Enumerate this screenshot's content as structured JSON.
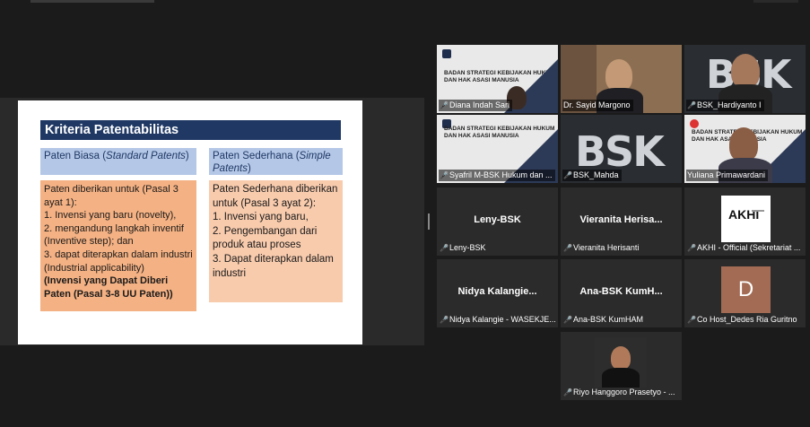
{
  "slide": {
    "title": "Kriteria Patentabilitas",
    "left_head_a": "Paten Biasa (",
    "left_head_i": "Standard Patents",
    "left_head_b": ")",
    "right_head_a": "Paten Sederhana (",
    "right_head_i": "Simple Patents",
    "right_head_b": ")",
    "left_body": [
      "Paten diberikan untuk (Pasal 3 ayat 1):",
      "1. Invensi yang baru (novelty),",
      "2. mengandung langkah inventif (Inventive step); dan",
      "3. dapat diterapkan dalam industri (Industrial applicability)"
    ],
    "left_bold": "(Invensi yang Dapat Diberi Paten (Pasal 3-8 UU Paten))",
    "right_body": [
      "Paten Sederhana diberikan untuk (Pasal 3 ayat 2):",
      "1. Invensi yang baru,",
      "2. Pengembangan dari produk atau proses",
      "3. Dapat diterapkan dalam industri"
    ]
  },
  "slide_thumb": {
    "org": "BADAN STRATEGI KEBIJAKAN HUKUM DAN HAK ASASI MANUSIA",
    "bsk": "BSK"
  },
  "participants": [
    {
      "caption": "Diana Indah Sari"
    },
    {
      "caption": "Dr. Sayid Margono"
    },
    {
      "caption": "BSK_Hardiyanto I"
    },
    {
      "caption": "Syafril M-BSK Hukum dan ..."
    },
    {
      "caption": "BSK_Mahda"
    },
    {
      "caption": "Yuliana Primawardani"
    },
    {
      "display": "Leny-BSK",
      "caption": "Leny-BSK"
    },
    {
      "display": "Vieranita Herisa...",
      "caption": "Vieranita Herisanti"
    },
    {
      "caption": "AKHI - Official (Sekretariat ..."
    },
    {
      "display": "Nidya Kalangie...",
      "caption": "Nidya Kalangie - WASEKJE..."
    },
    {
      "display": "Ana-BSK KumH...",
      "caption": "Ana-BSK KumHAM"
    },
    {
      "avatar": "D",
      "caption": "Co Host_Dedes Ria Guritno"
    },
    {
      "caption": "Riyo Hanggoro Prasetyo - ..."
    }
  ],
  "colors": {
    "title_bar": "#1f3864",
    "head_fill": "#b4c7e7",
    "left_fill": "#f4b183",
    "right_fill": "#f8cbad",
    "active_border": "#c8d22a",
    "muted_mic": "#e0312e"
  }
}
